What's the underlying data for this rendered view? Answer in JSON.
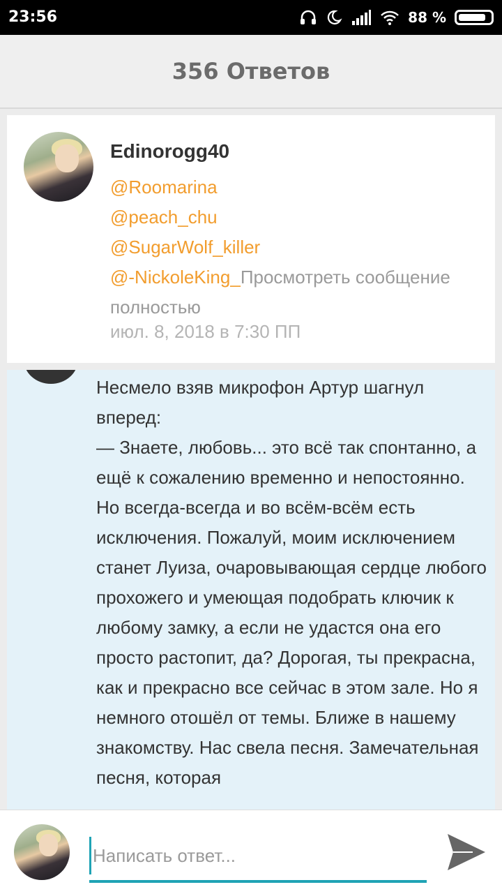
{
  "status_bar": {
    "time": "23:56",
    "battery_percent": "88 %",
    "battery_level": 0.88
  },
  "header": {
    "title": "356 Ответов"
  },
  "post": {
    "username": "Edinorogg40",
    "mentions": [
      "@Roomarina",
      "@peach_chu",
      "@SugarWolf_killer",
      "@-NickoleKing_"
    ],
    "view_full": "Просмотреть сообщение полностью",
    "date": "июл. 8, 2018 в 7:30 ПП"
  },
  "reply": {
    "text": "Несмело взяв микрофон Артур шагнул вперед:\n— Знаете, любовь... это всё так спонтанно, а ещё к сожалению временно и непостоянно. Но всегда-всегда и во всём-всём есть исключения. Пожалуй, моим исключением станет Луиза, очаровывающая сердце любого прохожего и умеющая подобрать ключик к любому замку, а если не удастся она его просто растопит, да? Дорогая, ты прекрасна, как и прекрасно все сейчас в этом зале. Но я немного отошёл от темы. Ближе в нашему знакомству. Нас свела песня. Замечательная песня, которая"
  },
  "composer": {
    "placeholder": "Написать ответ..."
  },
  "colors": {
    "mention": "#f29d2e",
    "accent": "#1fa3b5",
    "reply_bg": "#e4f2f9"
  }
}
